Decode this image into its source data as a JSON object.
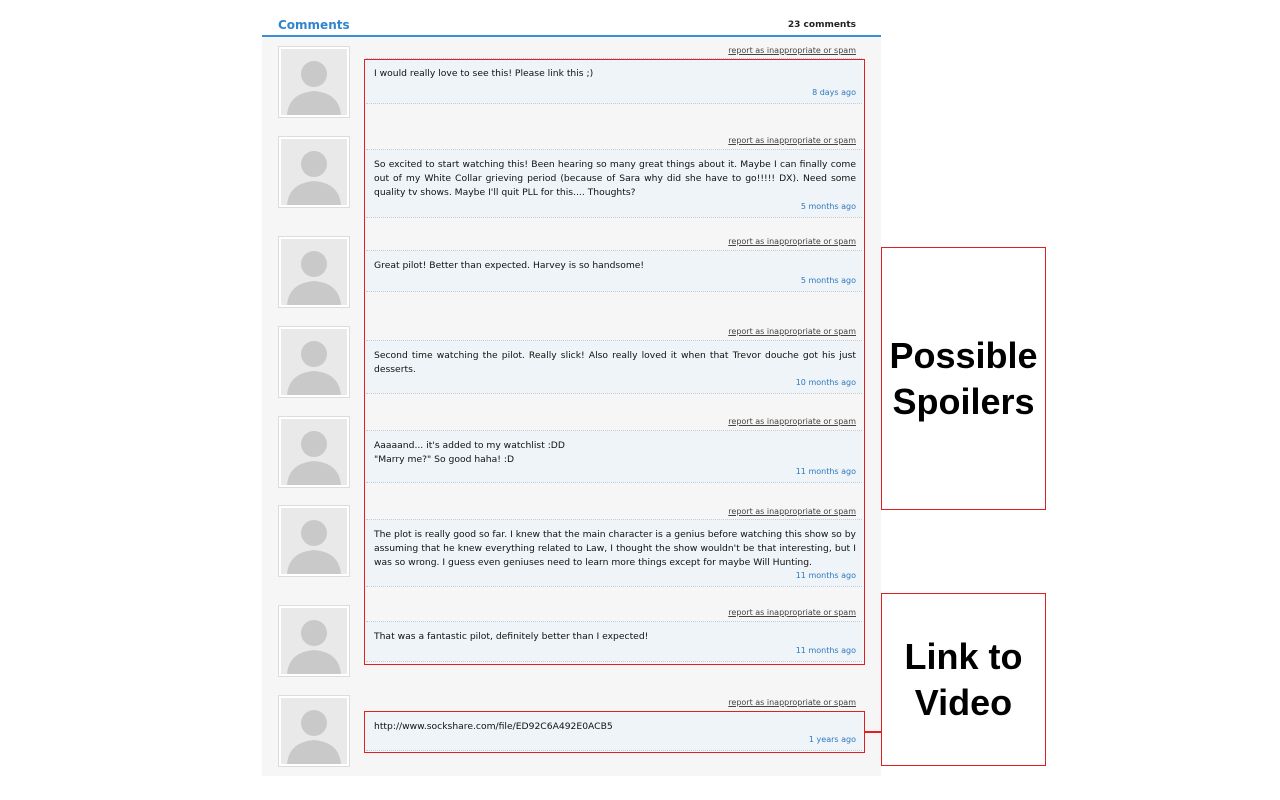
{
  "header": {
    "title": "Comments",
    "count": "23 comments"
  },
  "report_label": "report as inappropriate or spam",
  "comments": [
    {
      "text": "I would really love to see this! Please link this ;)",
      "time": "8 days ago"
    },
    {
      "text": "So excited to start watching this! Been hearing so many great things about it. Maybe I can finally come out of my White Collar grieving period (because of Sara why did she have to go!!!!! DX). Need some quality tv shows. Maybe I'll quit PLL for this.... Thoughts?",
      "time": "5 months ago"
    },
    {
      "text": "Great pilot! Better than expected. Harvey is so handsome!",
      "time": "5 months ago"
    },
    {
      "text": "Second time watching the pilot. Really slick! Also really loved it when that Trevor douche got his just desserts.",
      "time": "10 months ago"
    },
    {
      "text": "Aaaaand... it's added to my watchlist :DD\n\"Marry me?\" So good haha! :D",
      "time": "11 months ago"
    },
    {
      "text": "The plot is really good so far. I knew that the main character is a genius before watching this show so by assuming that he knew everything related to Law, I thought the show wouldn't be that interesting, but I was so wrong. I guess even geniuses need to learn more things except for maybe Will Hunting.",
      "time": "11 months ago"
    },
    {
      "text": "That was a fantastic pilot, definitely better than I expected!",
      "time": "11 months ago"
    },
    {
      "text": "http://www.sockshare.com/file/ED92C6A492E0ACB5",
      "time": "1 years ago"
    }
  ],
  "annotations": {
    "spoilers": "Possible\nSpoilers",
    "link": "Link to\nVideo"
  },
  "colors": {
    "accent": "#2f86cf",
    "annotation": "#e02020",
    "timestamp": "#2f78c2"
  }
}
